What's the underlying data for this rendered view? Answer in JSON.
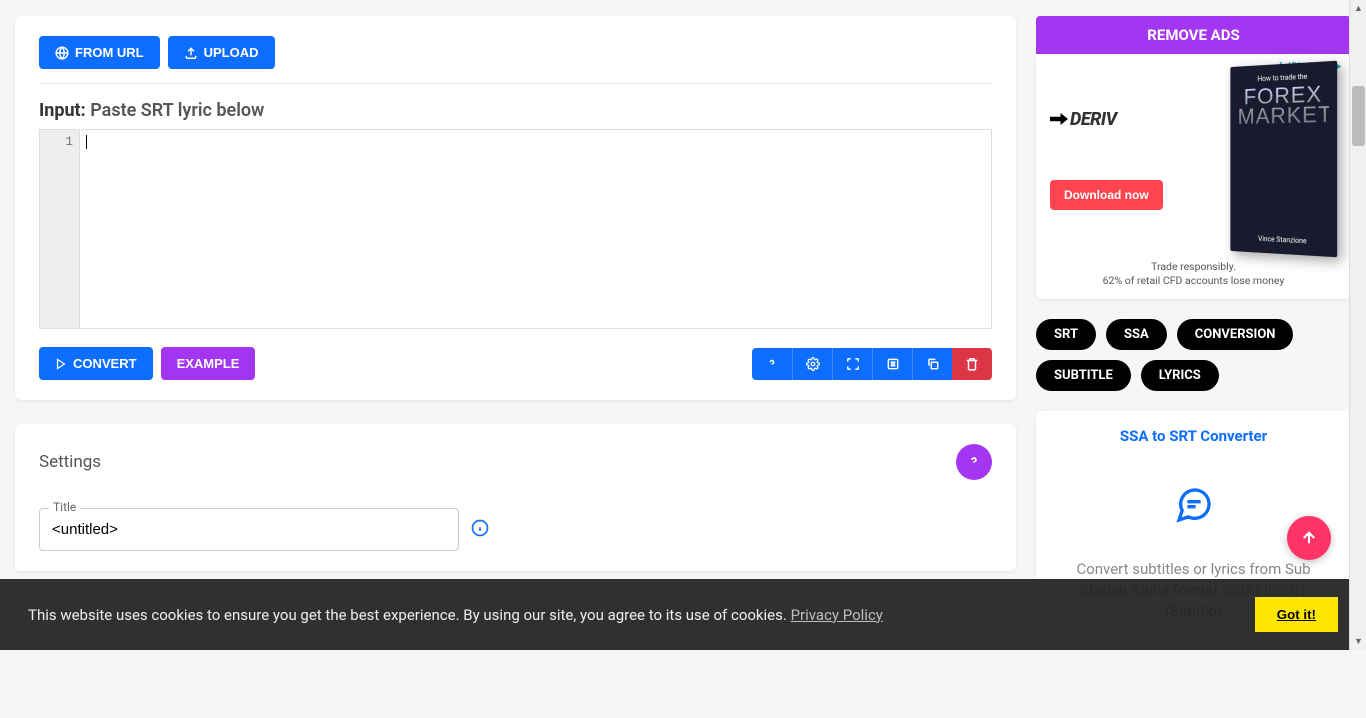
{
  "toolbar": {
    "from_url": "FROM URL",
    "upload": "UPLOAD"
  },
  "input_section": {
    "label_bold": "Input:",
    "label_rest": "Paste SRT lyric below",
    "line_number": "1"
  },
  "actions": {
    "convert": "CONVERT",
    "example": "EXAMPLE"
  },
  "settings": {
    "heading": "Settings",
    "title_label": "Title",
    "title_value": "<untitled>"
  },
  "sidebar": {
    "remove_ads": "REMOVE ADS",
    "ad": {
      "adchoices": "AdChoices",
      "brand": "DERIV",
      "book_pretitle": "How to trade the",
      "book_title_line1": "FOREX",
      "book_title_line2": "MARKET",
      "book_author": "Vince Stanzione",
      "cta": "Download now",
      "disclaimer_line1": "Trade responsibly.",
      "disclaimer_line2": "62% of retail CFD accounts lose money"
    },
    "tags": [
      "SRT",
      "SSA",
      "CONVERSION",
      "SUBTITLE",
      "LYRICS"
    ],
    "related": {
      "title": "SSA to SRT Converter",
      "desc": "Convert subtitles or lyrics from Sub Station Alpha format (SSA) to SRT (SubRip)"
    }
  },
  "cookie": {
    "text": "This website uses cookies to ensure you get the best experience. By using our site, you agree to its use of cookies.",
    "link": "Privacy Policy",
    "button": "Got it!"
  }
}
